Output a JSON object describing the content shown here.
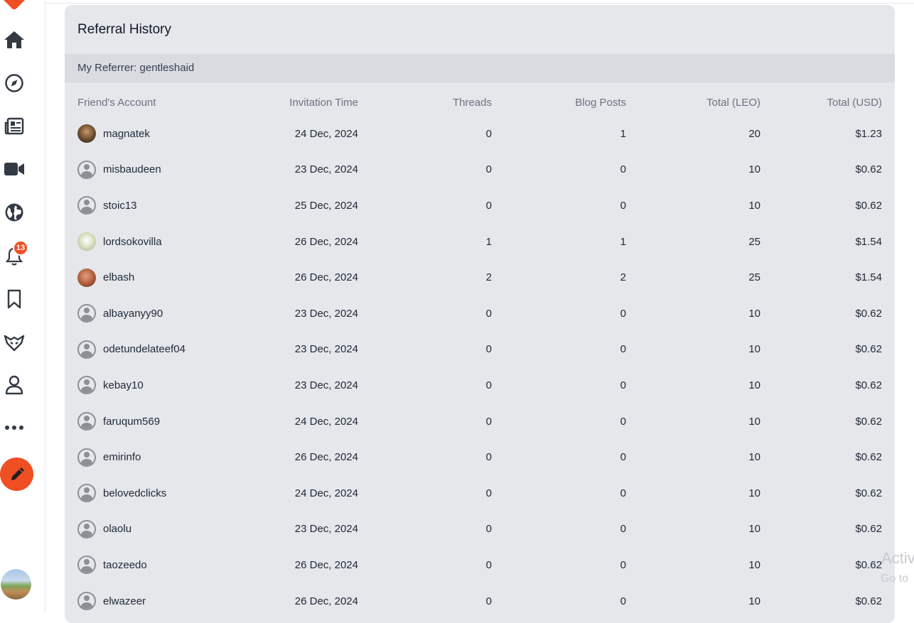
{
  "sidebar": {
    "items": [
      {
        "name": "home-icon"
      },
      {
        "name": "compass-icon"
      },
      {
        "name": "newspaper-icon"
      },
      {
        "name": "video-icon"
      },
      {
        "name": "globe-icon"
      },
      {
        "name": "bell-icon"
      },
      {
        "name": "bookmark-icon"
      },
      {
        "name": "leo-lion-icon"
      },
      {
        "name": "user-icon"
      },
      {
        "name": "more-icon"
      }
    ],
    "notification_count": "13",
    "compose_icon": "pencil-icon",
    "accent": "#f04e23"
  },
  "card": {
    "title": "Referral History",
    "referrer": "My Referrer: gentleshaid"
  },
  "table": {
    "columns": [
      "Friend's Account",
      "Invitation Time",
      "Threads",
      "Blog Posts",
      "Total (LEO)",
      "Total (USD)"
    ],
    "rows": [
      {
        "account": "magnatek",
        "time": "24 Dec, 2024",
        "threads": "0",
        "posts": "1",
        "leo": "20",
        "usd": "$1.23",
        "avatar": "magnatek"
      },
      {
        "account": "misbaudeen",
        "time": "23 Dec, 2024",
        "threads": "0",
        "posts": "0",
        "leo": "10",
        "usd": "$0.62",
        "avatar": "default"
      },
      {
        "account": "stoic13",
        "time": "25 Dec, 2024",
        "threads": "0",
        "posts": "0",
        "leo": "10",
        "usd": "$0.62",
        "avatar": "default"
      },
      {
        "account": "lordsokovilla",
        "time": "26 Dec, 2024",
        "threads": "1",
        "posts": "1",
        "leo": "25",
        "usd": "$1.54",
        "avatar": "lord"
      },
      {
        "account": "elbash",
        "time": "26 Dec, 2024",
        "threads": "2",
        "posts": "2",
        "leo": "25",
        "usd": "$1.54",
        "avatar": "elbash"
      },
      {
        "account": "albayanyy90",
        "time": "23 Dec, 2024",
        "threads": "0",
        "posts": "0",
        "leo": "10",
        "usd": "$0.62",
        "avatar": "default"
      },
      {
        "account": "odetundelateef04",
        "time": "23 Dec, 2024",
        "threads": "0",
        "posts": "0",
        "leo": "10",
        "usd": "$0.62",
        "avatar": "default"
      },
      {
        "account": "kebay10",
        "time": "23 Dec, 2024",
        "threads": "0",
        "posts": "0",
        "leo": "10",
        "usd": "$0.62",
        "avatar": "default"
      },
      {
        "account": "faruqum569",
        "time": "24 Dec, 2024",
        "threads": "0",
        "posts": "0",
        "leo": "10",
        "usd": "$0.62",
        "avatar": "default"
      },
      {
        "account": "emirinfo",
        "time": "26 Dec, 2024",
        "threads": "0",
        "posts": "0",
        "leo": "10",
        "usd": "$0.62",
        "avatar": "default"
      },
      {
        "account": "belovedclicks",
        "time": "24 Dec, 2024",
        "threads": "0",
        "posts": "0",
        "leo": "10",
        "usd": "$0.62",
        "avatar": "default"
      },
      {
        "account": "olaolu",
        "time": "23 Dec, 2024",
        "threads": "0",
        "posts": "0",
        "leo": "10",
        "usd": "$0.62",
        "avatar": "default"
      },
      {
        "account": "taozeedo",
        "time": "26 Dec, 2024",
        "threads": "0",
        "posts": "0",
        "leo": "10",
        "usd": "$0.62",
        "avatar": "default"
      },
      {
        "account": "elwazeer",
        "time": "26 Dec, 2024",
        "threads": "0",
        "posts": "0",
        "leo": "10",
        "usd": "$0.62",
        "avatar": "default"
      }
    ]
  },
  "watermark": {
    "line1": "Activ",
    "line2": "Go to"
  }
}
